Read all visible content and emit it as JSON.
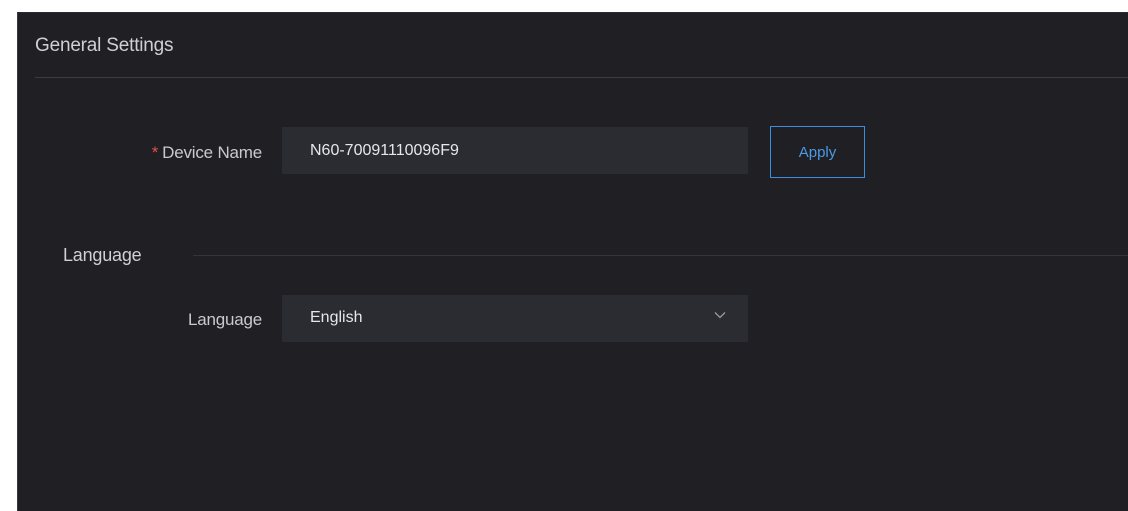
{
  "panel": {
    "title": "General Settings"
  },
  "device_name": {
    "required_mark": "*",
    "label": "Device Name",
    "value": "N60-70091110096F9",
    "apply_label": "Apply"
  },
  "language_section": {
    "title": "Language",
    "field_label": "Language",
    "selected": "English",
    "icon": "chevron-down-icon"
  },
  "colors": {
    "background": "#1f1f24",
    "input_bg": "#2b2c31",
    "accent": "#3d8ee0",
    "required": "#e0504a"
  }
}
